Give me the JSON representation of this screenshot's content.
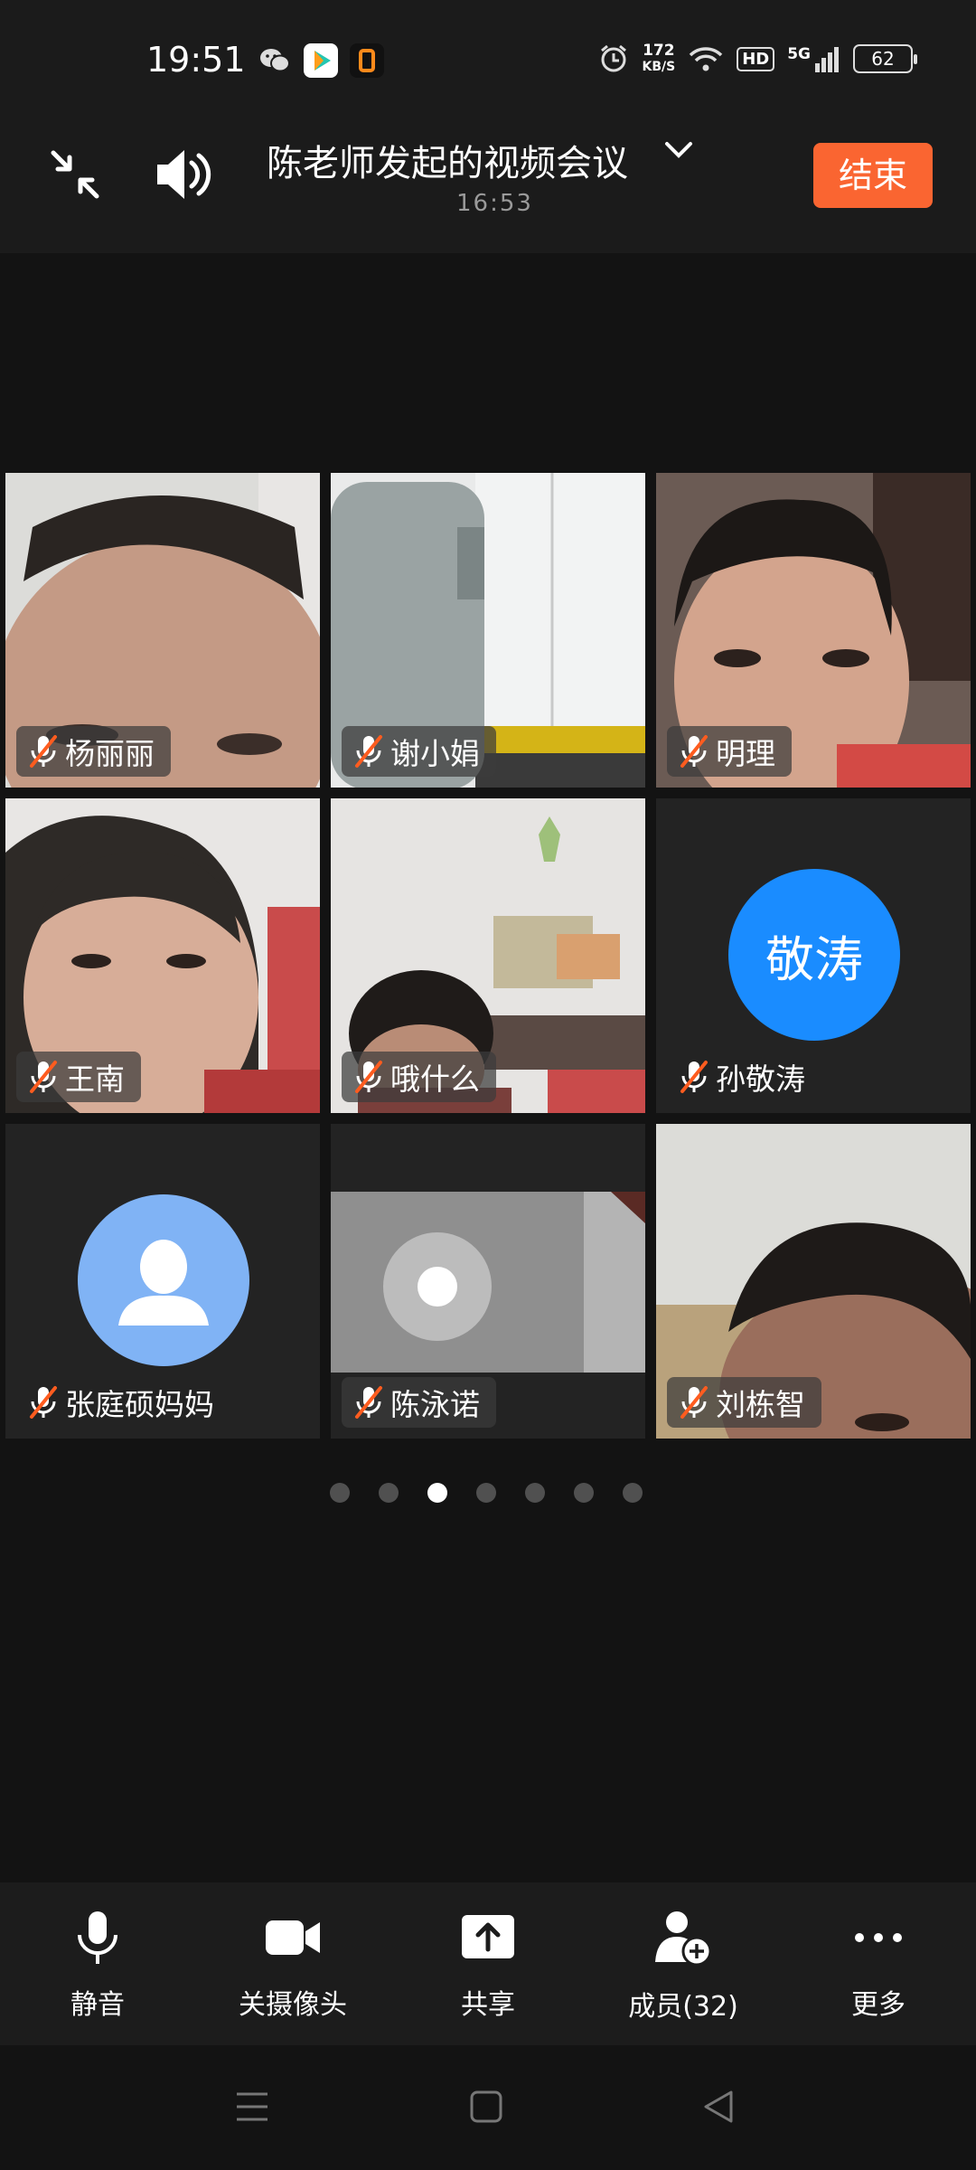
{
  "status_bar": {
    "time": "19:51",
    "net_speed_value": "172",
    "net_speed_unit": "KB/S",
    "hd_label": "HD",
    "network_label": "5G",
    "battery": "62"
  },
  "header": {
    "title": "陈老师发起的视频会议",
    "timer": "16:53",
    "end_button": "结束"
  },
  "participants": [
    {
      "name": "杨丽丽",
      "muted": true
    },
    {
      "name": "谢小娟",
      "muted": true
    },
    {
      "name": "明理",
      "muted": true
    },
    {
      "name": "王南",
      "muted": true
    },
    {
      "name": "哦什么",
      "muted": true
    },
    {
      "name": "孙敬涛",
      "muted": true,
      "avatar_text": "敬涛",
      "avatar_color": "#1a8cff"
    },
    {
      "name": "张庭硕妈妈",
      "muted": true,
      "avatar_icon": "person-icon",
      "avatar_color": "#80b3f5"
    },
    {
      "name": "陈泳诺",
      "muted": true
    },
    {
      "name": "刘栋智",
      "muted": true
    }
  ],
  "pagination": {
    "total": 7,
    "current": 3
  },
  "toolbar": {
    "mute": "静音",
    "camera_off": "关摄像头",
    "share": "共享",
    "members": "成员(32)",
    "more": "更多"
  },
  "colors": {
    "accent": "#fa6531",
    "mic_off": "#ff5c1f",
    "background": "#131313"
  }
}
